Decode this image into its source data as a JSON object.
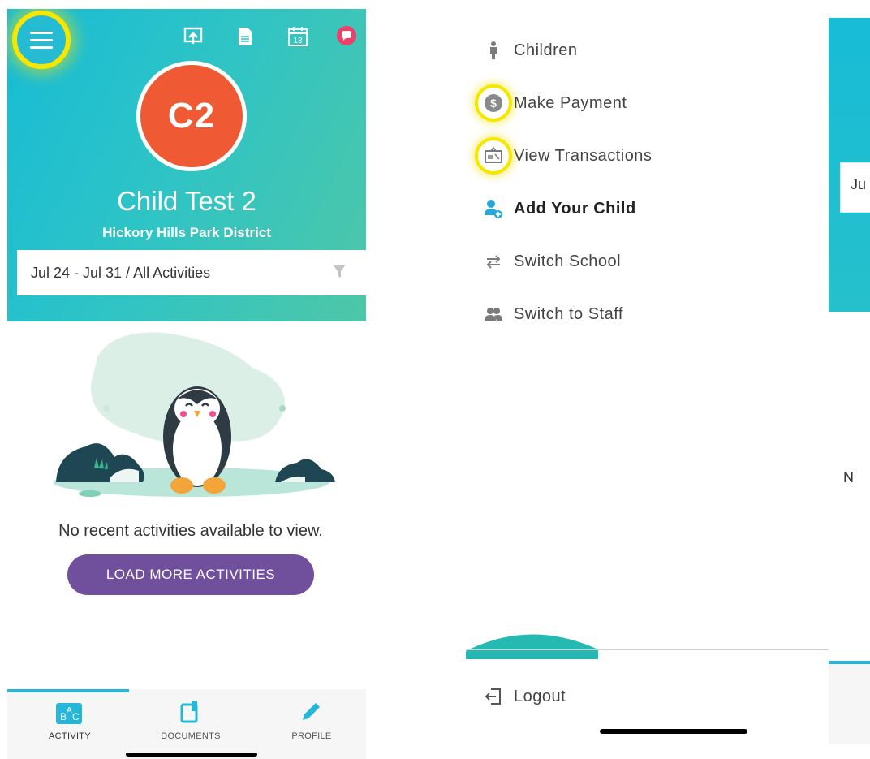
{
  "phone_activity": {
    "header_icons": [
      "menu-icon",
      "upload-board-icon",
      "document-icon",
      "calendar-icon",
      "chat-icon"
    ],
    "calendar_day": "13",
    "avatar_initials": "C2",
    "child_name": "Child Test 2",
    "school_name": "Hickory Hills Park District",
    "filter_text": "Jul 24 - Jul 31 / All Activities",
    "empty_message": "No recent activities available to view.",
    "load_more_label": "LOAD MORE ACTIVITIES",
    "tabs": [
      {
        "label": "ACTIVITY",
        "icon": "abc-blocks-icon",
        "active": true
      },
      {
        "label": "DOCUMENTS",
        "icon": "clipboard-icon",
        "active": false
      },
      {
        "label": "PROFILE",
        "icon": "pencil-icon",
        "active": false
      }
    ],
    "colors": {
      "hero_start": "#17bcd6",
      "hero_end": "#52c7a4",
      "avatar": "#ef5a34",
      "button": "#704f9c",
      "highlight": "#f6e600"
    }
  },
  "drawer_menu": {
    "items": [
      {
        "label": "Children",
        "icon": "child-icon"
      },
      {
        "label": "Make Payment",
        "icon": "dollar-icon"
      },
      {
        "label": "View Transactions",
        "icon": "receipt-icon"
      },
      {
        "label": "Add Your Child",
        "icon": "add-user-icon"
      },
      {
        "label": "Switch School",
        "icon": "switch-arrows-icon"
      },
      {
        "label": "Switch to Staff",
        "icon": "staff-icon"
      }
    ],
    "logout_label": "Logout"
  },
  "background_screen": {
    "date_fragment": "Ju",
    "text_fragment": "N"
  }
}
